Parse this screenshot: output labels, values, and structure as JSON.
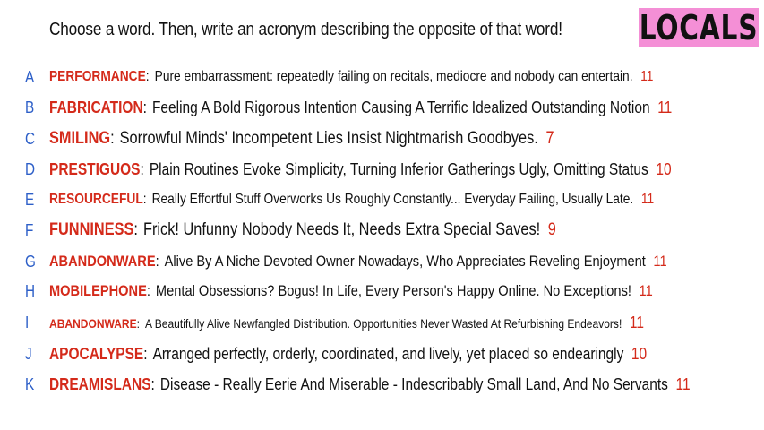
{
  "header": {
    "prompt": "Choose a word. Then, write an acronym describing the opposite of that word!",
    "logo": "LOCALS"
  },
  "entries": [
    {
      "letter": "A",
      "word": "PERFORMANCE",
      "text": "Pure embarrassment: repeatedly failing on recitals, mediocre and nobody can entertain.",
      "count": "11"
    },
    {
      "letter": "B",
      "word": "FABRICATION",
      "text": "Feeling A Bold Rigorous Intention Causing A Terrific Idealized Outstanding Notion",
      "count": "11"
    },
    {
      "letter": "C",
      "word": "SMILING",
      "text": "Sorrowful Minds' Incompetent Lies Insist Nightmarish Goodbyes.",
      "count": "7"
    },
    {
      "letter": "D",
      "word": "PRESTIGUOS",
      "text": "Plain Routines Evoke Simplicity, Turning Inferior Gatherings Ugly, Omitting Status",
      "count": "10"
    },
    {
      "letter": "E",
      "word": "RESOURCEFUL",
      "text": "Really Effortful Stuff Overworks Us Roughly Constantly... Everyday Failing, Usually Late.",
      "count": "11"
    },
    {
      "letter": "F",
      "word": "FUNNINESS",
      "text": "Frick! Unfunny Nobody Needs It, Needs Extra Special Saves!",
      "count": "9"
    },
    {
      "letter": "G",
      "word": "ABANDONWARE",
      "text": "Alive By A Niche Devoted Owner Nowadays, Who Appreciates Reveling Enjoyment",
      "count": "11"
    },
    {
      "letter": "H",
      "word": "MOBILEPHONE",
      "text": "Mental Obsessions? Bogus! In Life, Every Person's Happy Online. No Exceptions!",
      "count": "11"
    },
    {
      "letter": "I",
      "word": "ABANDONWARE",
      "text": "A Beautifully Alive Newfangled Distribution. Opportunities Never Wasted At Refurbishing Endeavors!",
      "count": "11"
    },
    {
      "letter": "J",
      "word": "APOCALYPSE",
      "text": "Arranged perfectly, orderly, coordinated, and lively, yet placed so endearingly",
      "count": "10"
    },
    {
      "letter": "K",
      "word": "DREAMISLANS",
      "text": "Disease - Really Eerie And Miserable - Indescribably Small Land, And No Servants",
      "count": "11"
    }
  ]
}
